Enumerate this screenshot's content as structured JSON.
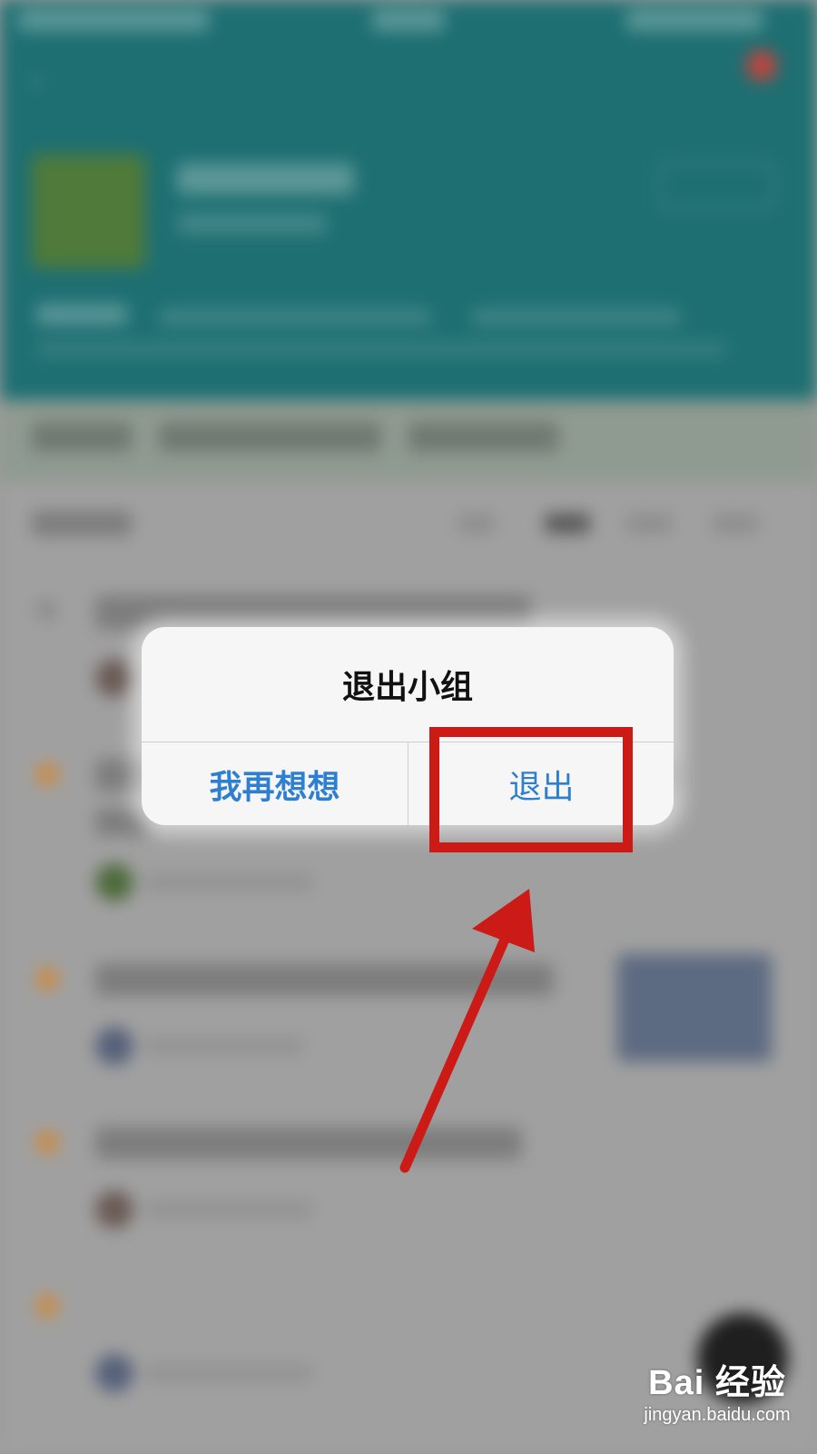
{
  "dialog": {
    "title": "退出小组",
    "cancel_label": "我再想想",
    "confirm_label": "退出"
  },
  "annotation": {
    "highlight_color": "#cc1a17",
    "arrow_color": "#cc1a17"
  },
  "watermark": {
    "logo_text": "Bai 经验",
    "url": "jingyan.baidu.com"
  },
  "colors": {
    "header_bg": "#1e6f72",
    "dialog_bg": "#f6f6f7",
    "action_blue": "#2f7fd0"
  },
  "background_icons": {
    "back": "back-arrow-icon",
    "avatar": "group-avatar-icon",
    "compose": "compose-fab-icon"
  }
}
